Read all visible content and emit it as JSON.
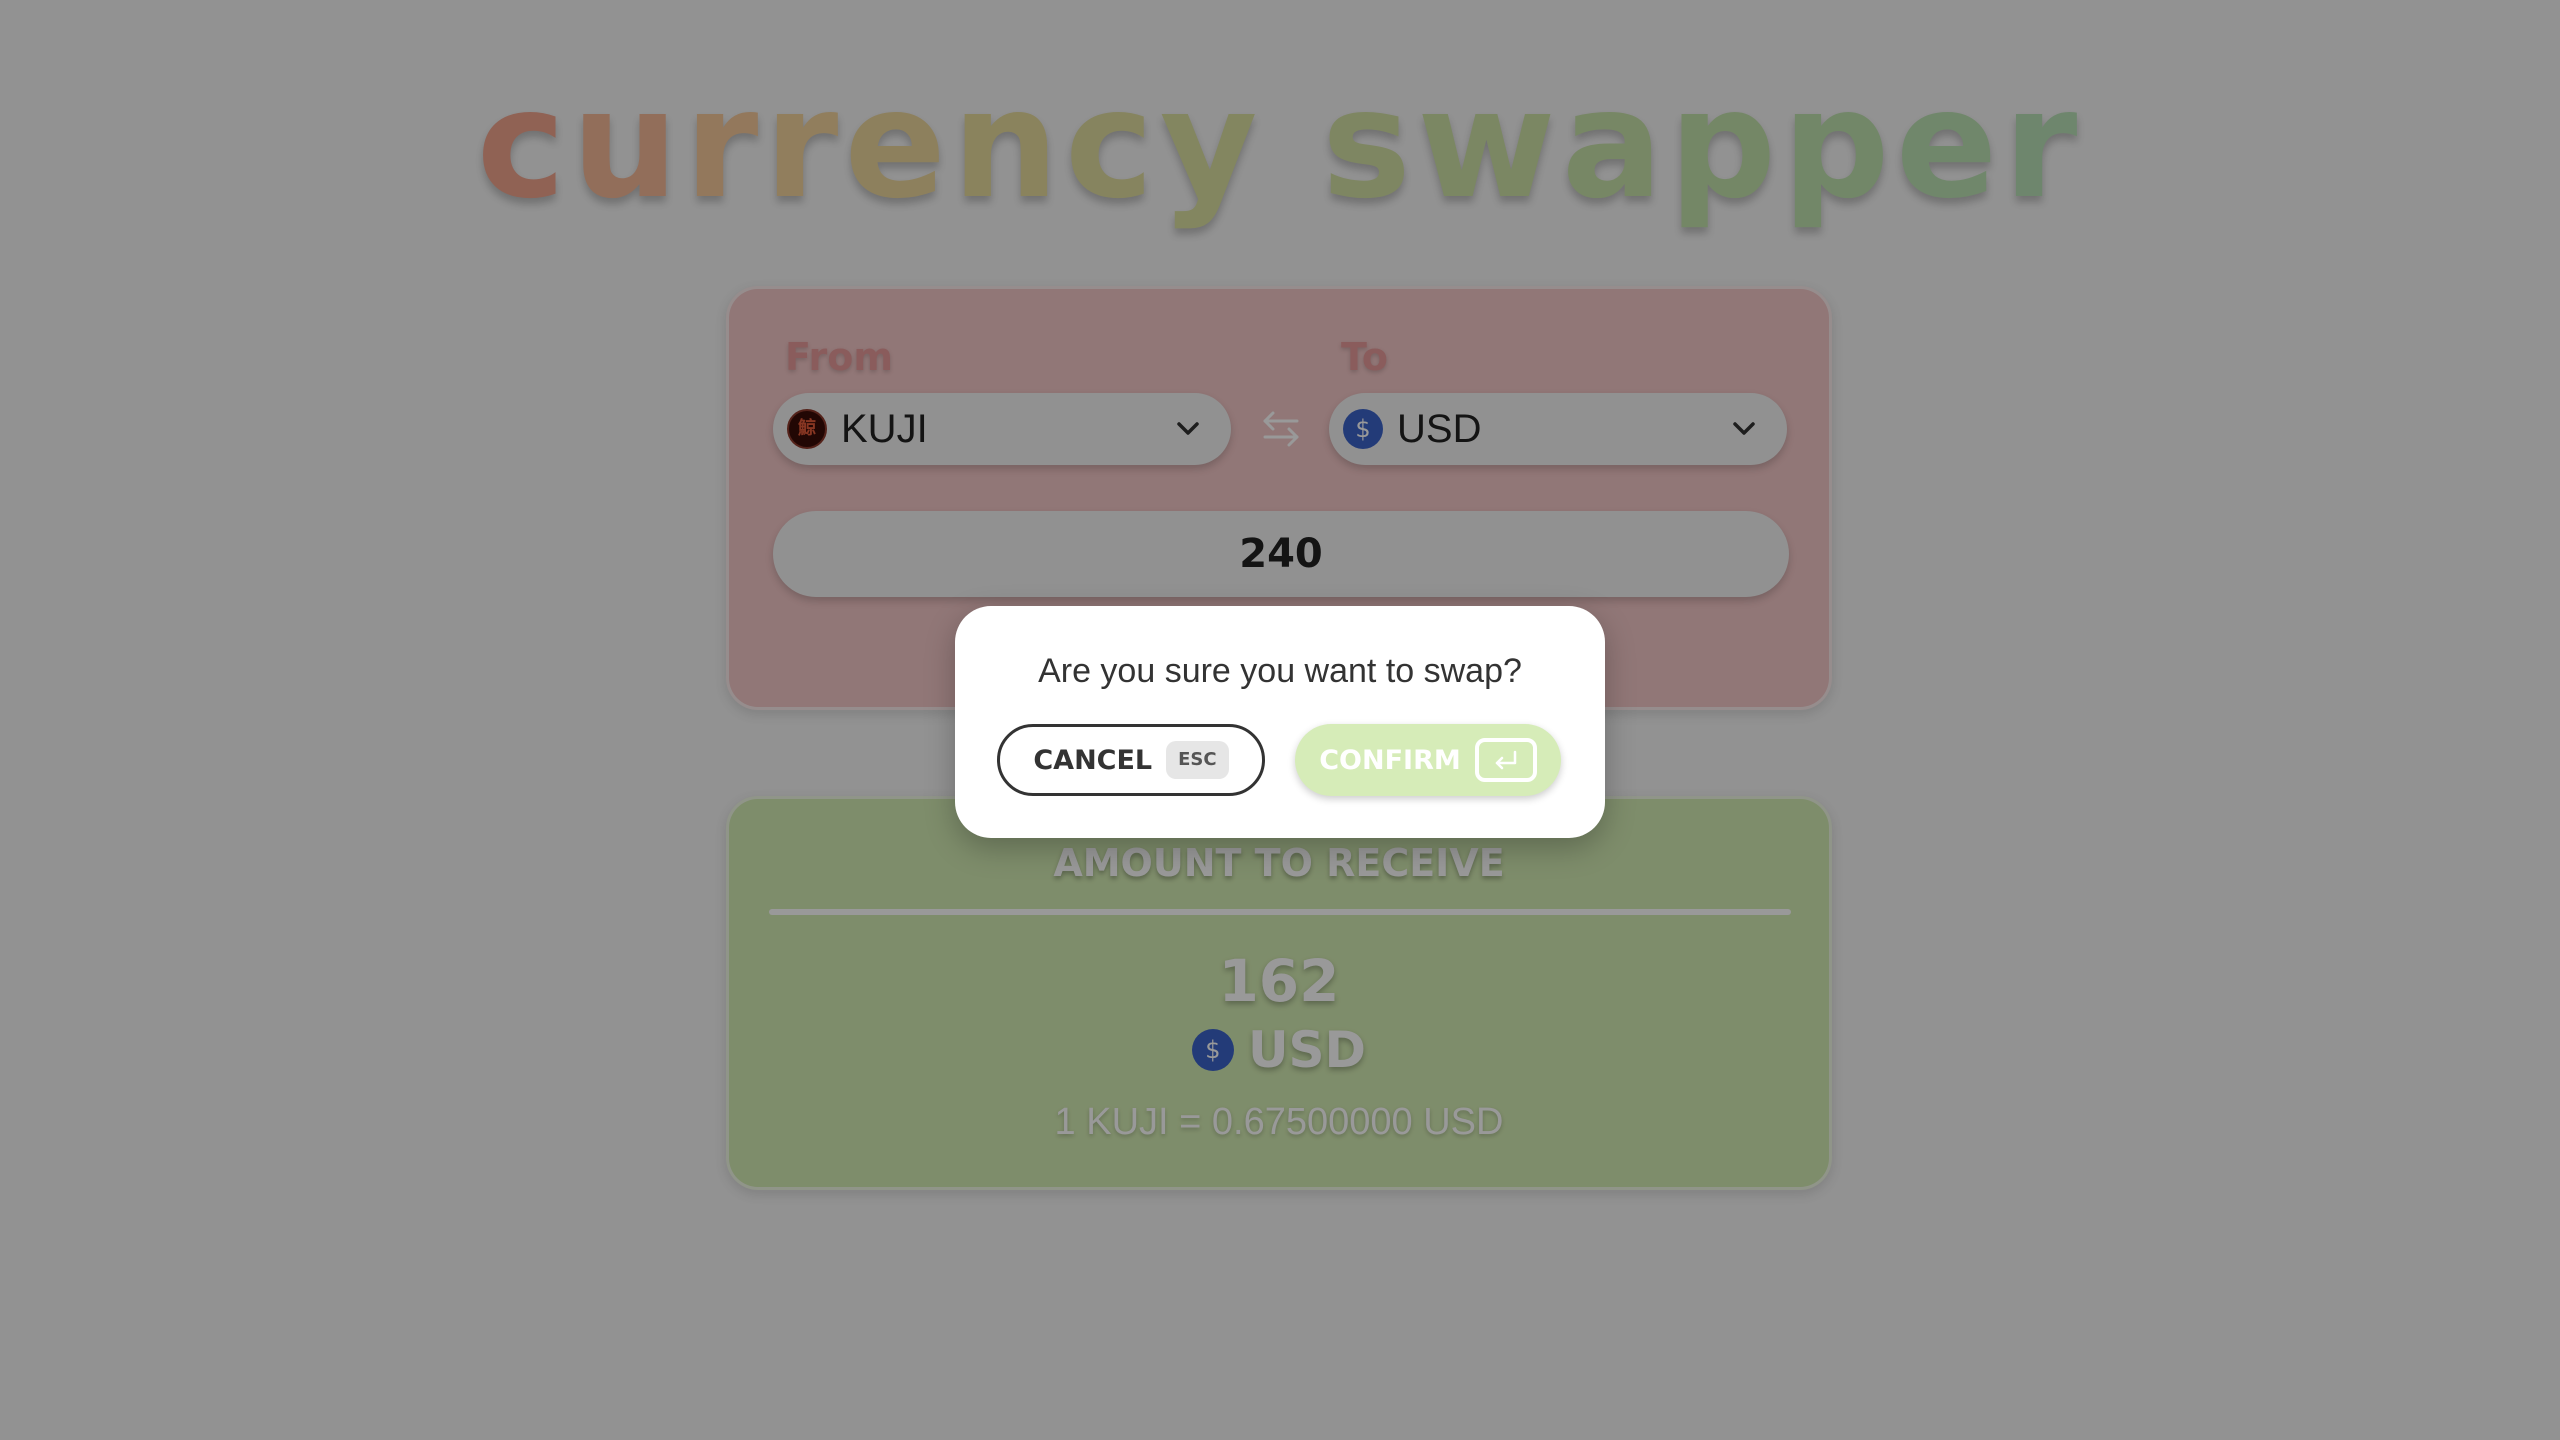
{
  "app": {
    "title_words": [
      "currency",
      "swapper"
    ],
    "title_colors": [
      "#f0a38d",
      "#f4b796",
      "#f5c89a",
      "#f2d29c",
      "#ecd59b",
      "#e6da9c",
      "#e0dc9f",
      "#dadfa1",
      "#d3e0a3",
      "#cde1a6",
      "#c7e1a8",
      "#c2e2ab",
      "#bee2ae",
      "#bbe1b2",
      "#b8e0b6"
    ]
  },
  "swap_form": {
    "from_label": "From",
    "to_label": "To",
    "from_currency": {
      "code": "KUJI",
      "icon": "kuji-coin-icon",
      "glyph": "鯨"
    },
    "to_currency": {
      "code": "USD",
      "icon": "dollar-coin-icon",
      "glyph": "$"
    },
    "swap_icon": "swap-arrows-icon",
    "amount": "240"
  },
  "receive": {
    "heading": "AMOUNT TO RECEIVE",
    "amount": "162",
    "currency": "USD",
    "currency_glyph": "$",
    "rate": "1 KUJI = 0.67500000 USD"
  },
  "modal": {
    "question": "Are you sure you want to swap?",
    "cancel_label": "CANCEL",
    "cancel_key": "ESC",
    "confirm_label": "CONFIRM",
    "confirm_key_icon": "enter-key-icon"
  },
  "colors": {
    "from_panel": "#f2c6c6",
    "receive_panel": "#d3ebb2",
    "confirm_button": "#d6ecb8",
    "usd_icon": "#3b63c9",
    "overlay": "rgba(0,0,0,0.4)"
  }
}
